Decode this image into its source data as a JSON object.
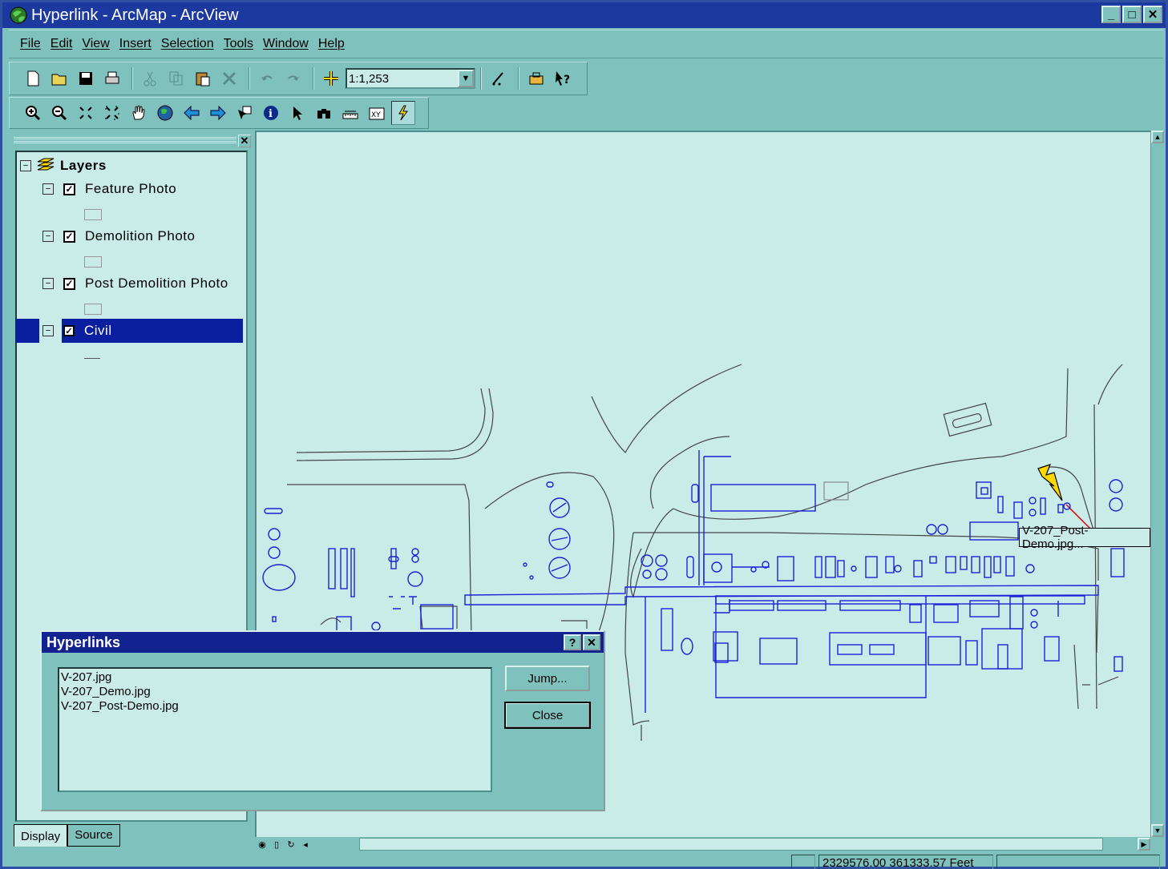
{
  "window": {
    "title": "Hyperlink - ArcMap - ArcView",
    "controls": [
      "_",
      "□",
      "✕"
    ]
  },
  "menu": [
    "File",
    "Edit",
    "View",
    "Insert",
    "Selection",
    "Tools",
    "Window",
    "Help"
  ],
  "toolbar": {
    "scale": "1:1,253"
  },
  "toc": {
    "root": "Layers",
    "layers": [
      {
        "label": "Feature Photo",
        "checked": true
      },
      {
        "label": "Demolition Photo",
        "checked": true
      },
      {
        "label": "Post Demolition Photo",
        "checked": true
      },
      {
        "label": "Civil",
        "checked": true,
        "selected": true
      }
    ],
    "tabs": [
      "Display",
      "Source"
    ]
  },
  "dialog": {
    "title": "Hyperlinks",
    "help": "?",
    "close": "✕",
    "items": [
      "V-207.jpg",
      "V-207_Demo.jpg",
      "V-207_Post-Demo.jpg"
    ],
    "jump_label": "Jump...",
    "close_label": "Close"
  },
  "map": {
    "tooltip": "V-207_Post-Demo.jpg..."
  },
  "status": {
    "coords": "2329576.00  361333.57 Feet"
  },
  "colors": {
    "background": "#7fc1bd",
    "titlebar": "#1c39a0",
    "map": "#c9ece8",
    "civil_blue": "#1a22d8"
  }
}
